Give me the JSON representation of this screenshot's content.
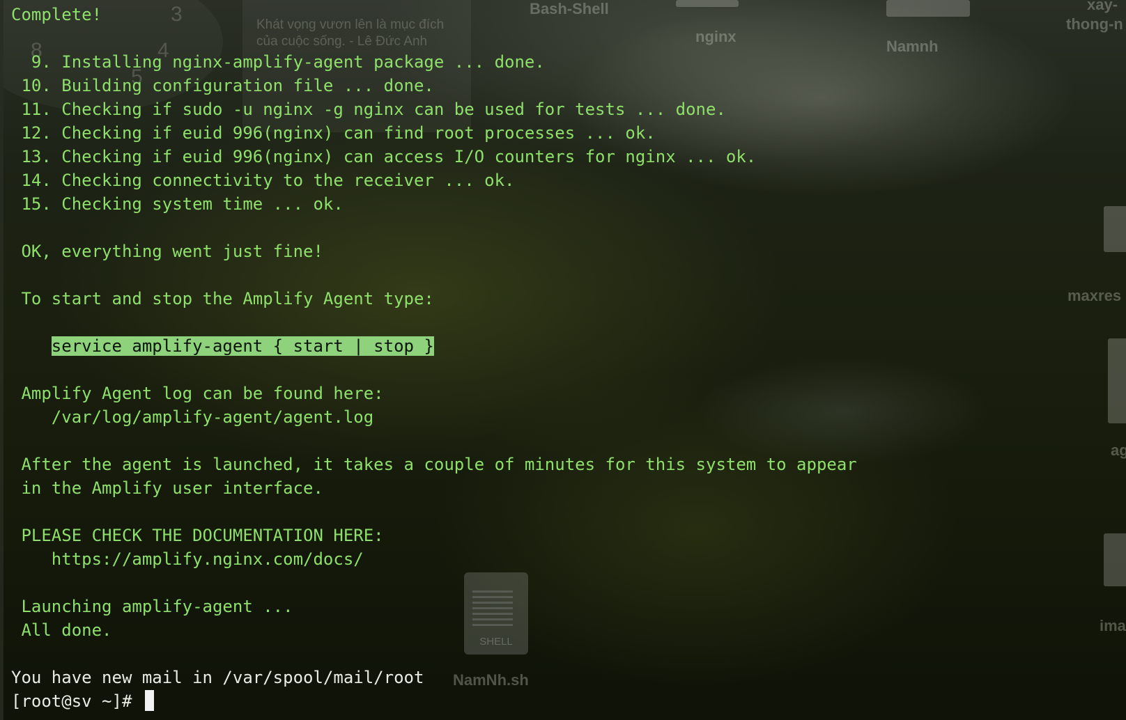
{
  "desktop": {
    "labels": {
      "bash_shell": "Bash-Shell",
      "nginx": "nginx",
      "namnh": "Namnh",
      "xay": "xay-",
      "thong": "thong-n",
      "maxres": "maxres",
      "ag": "ag",
      "ima": "ima",
      "namnh_sh": "NamNh.sh",
      "shell_ext": "SHELL"
    },
    "note_text": "Khát vọng vươn lên là mục đích của cuộc sống. - Lê Đức Anh",
    "clock_numbers": [
      "3",
      "8",
      "4",
      "5"
    ]
  },
  "terminal": {
    "lines": {
      "complete": "Complete!",
      "s9": "  9. Installing nginx-amplify-agent package ... done.",
      "s10": " 10. Building configuration file ... done.",
      "s11": " 11. Checking if sudo -u nginx -g nginx can be used for tests ... done.",
      "s12": " 12. Checking if euid 996(nginx) can find root processes ... ok.",
      "s13": " 13. Checking if euid 996(nginx) can access I/O counters for nginx ... ok.",
      "s14": " 14. Checking connectivity to the receiver ... ok.",
      "s15": " 15. Checking system time ... ok.",
      "ok": " OK, everything went just fine!",
      "to_start": " To start and stop the Amplify Agent type:",
      "indent": "    ",
      "service_cmd": "service amplify-agent { start | stop }",
      "log_found": " Amplify Agent log can be found here:",
      "log_path": "    /var/log/amplify-agent/agent.log",
      "after1": " After the agent is launched, it takes a couple of minutes for this system to appear",
      "after2": " in the Amplify user interface.",
      "please": " PLEASE CHECK THE DOCUMENTATION HERE:",
      "docs_url": "    https://amplify.nginx.com/docs/",
      "launching": " Launching amplify-agent ...",
      "all_done": " All done.",
      "mail": "You have new mail in /var/spool/mail/root",
      "prompt": "[root@sv ~]# "
    }
  },
  "colors": {
    "terminal_text": "#8ee06a",
    "highlight_bg": "#8ed37c",
    "plain_text": "#e8ece4"
  }
}
